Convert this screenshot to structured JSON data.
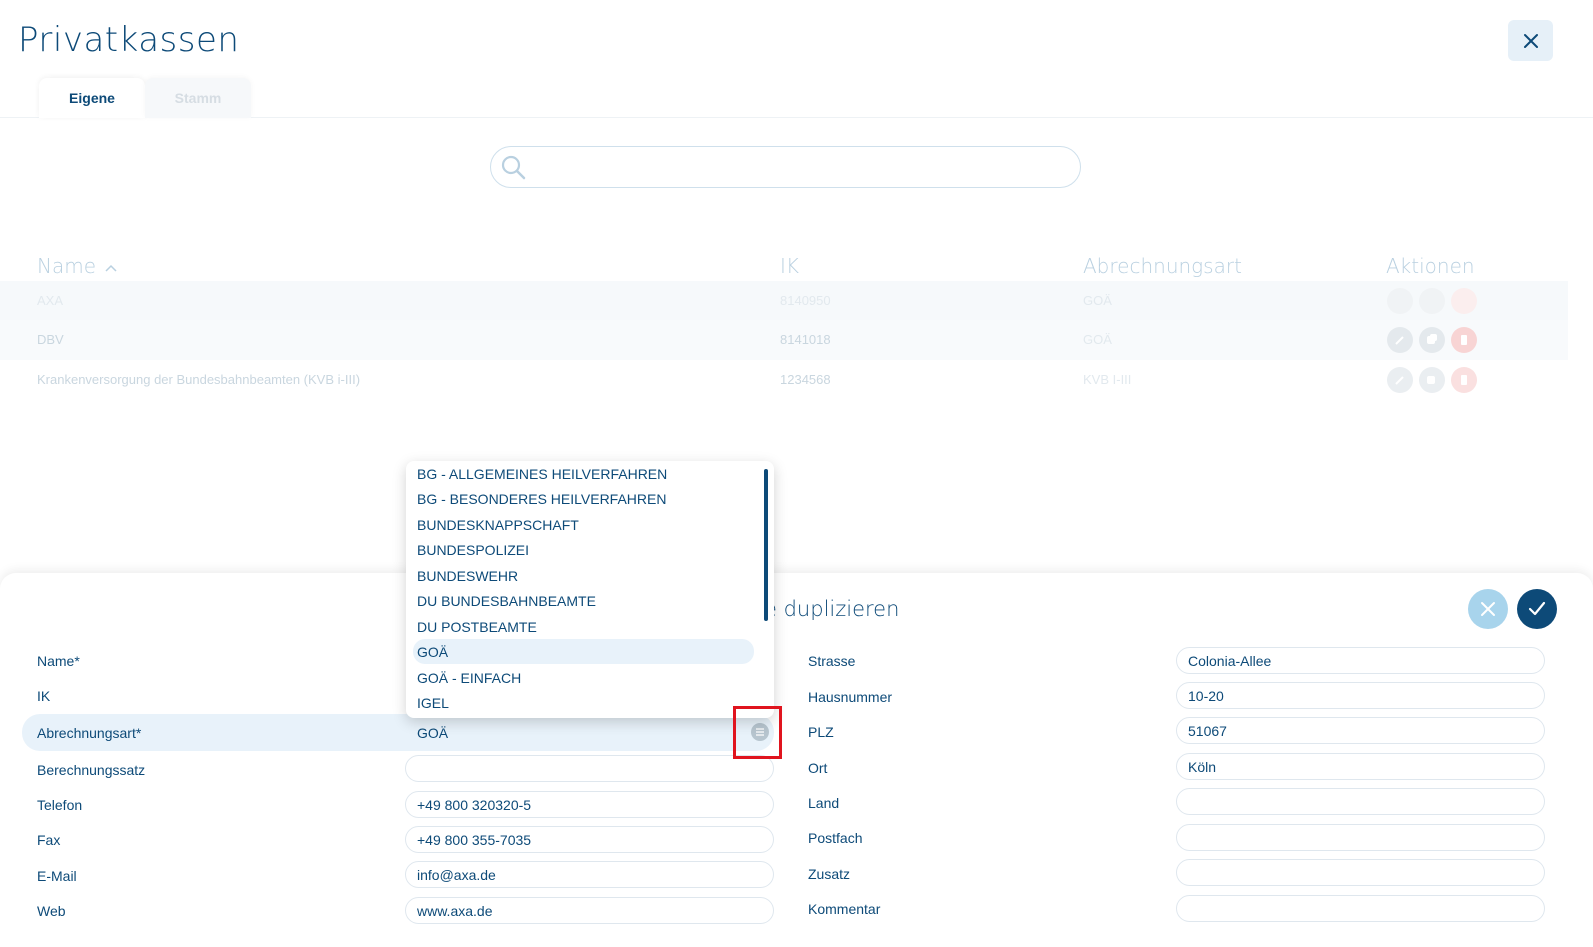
{
  "page": {
    "title": "Privatkassen"
  },
  "tabs": [
    {
      "label": "Eigene",
      "active": true
    },
    {
      "label": "Stamm",
      "active": false
    }
  ],
  "search": {
    "value": "",
    "placeholder": ""
  },
  "table": {
    "columns": [
      "Name",
      "IK",
      "Abrechnungsart",
      "Aktionen"
    ],
    "rows": [
      {
        "name": "AXA",
        "ik": "8140950",
        "abrechnungsart": "GOÄ"
      },
      {
        "name": "DBV",
        "ik": "8141018",
        "abrechnungsart": "GOÄ"
      },
      {
        "name": "Krankenversorgung der Bundesbahnbeamten (KVB i-III)",
        "ik": "1234568",
        "abrechnungsart": "KVB I-III"
      }
    ]
  },
  "dropdown": {
    "options": [
      "BG - ALLGEMEINES HEILVERFAHREN",
      "BG - BESONDERES HEILVERFAHREN",
      "BUNDESKNAPPSCHAFT",
      "BUNDESPOLIZEI",
      "BUNDESWEHR",
      "DU BUNDESBAHNBEAMTE",
      "DU POSTBEAMTE",
      "GOÄ",
      "GOÄ - EINFACH",
      "IGEL"
    ],
    "selected": "GOÄ"
  },
  "form": {
    "title": "e duplizieren",
    "left": {
      "name_label": "Name*",
      "ik_label": "IK",
      "abrechnungsart_label": "Abrechnungsart*",
      "abrechnungsart_value": "GOÄ",
      "berechnungssatz_label": "Berechnungssatz",
      "berechnungssatz_value": "",
      "telefon_label": "Telefon",
      "telefon_value": "+49 800 320320-5",
      "fax_label": "Fax",
      "fax_value": "+49 800 355-7035",
      "email_label": "E-Mail",
      "email_value": "info@axa.de",
      "web_label": "Web",
      "web_value": "www.axa.de"
    },
    "right": {
      "strasse_label": "Strasse",
      "strasse_value": "Colonia-Allee",
      "hausnummer_label": "Hausnummer",
      "hausnummer_value": "10-20",
      "plz_label": "PLZ",
      "plz_value": "51067",
      "ort_label": "Ort",
      "ort_value": "Köln",
      "land_label": "Land",
      "land_value": "",
      "postfach_label": "Postfach",
      "postfach_value": "",
      "zusatz_label": "Zusatz",
      "zusatz_value": "",
      "kommentar_label": "Kommentar",
      "kommentar_value": ""
    }
  },
  "colors": {
    "primary": "#0d4a78",
    "accent_light": "#a8d4ec",
    "highlight": "#e8f2fa",
    "danger": "#e0141e"
  }
}
